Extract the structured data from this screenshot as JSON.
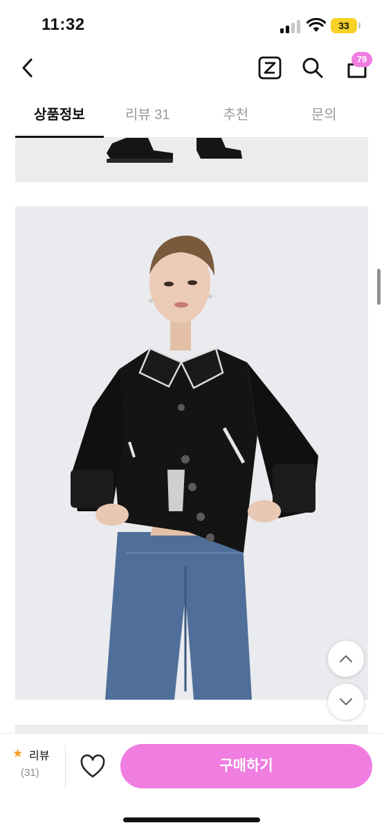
{
  "status_bar": {
    "time": "11:32",
    "battery": "33"
  },
  "header": {
    "cart_count": "79",
    "z_label": "Z"
  },
  "tabs": [
    {
      "label": "상품정보",
      "active": true
    },
    {
      "label": "리뷰 31",
      "active": false
    },
    {
      "label": "추천",
      "active": false
    },
    {
      "label": "문의",
      "active": false
    }
  ],
  "bottom_bar": {
    "review_label": "리뷰",
    "review_count": "(31)",
    "buy_label": "구매하기"
  },
  "icons": [
    "back-icon",
    "z-icon",
    "search-icon",
    "bag-icon",
    "heart-icon",
    "star-icon",
    "chevron-up-icon",
    "chevron-down-icon"
  ],
  "colors": {
    "accent": "#f07ee0",
    "star": "#f59b24",
    "battery": "#f7d126"
  }
}
